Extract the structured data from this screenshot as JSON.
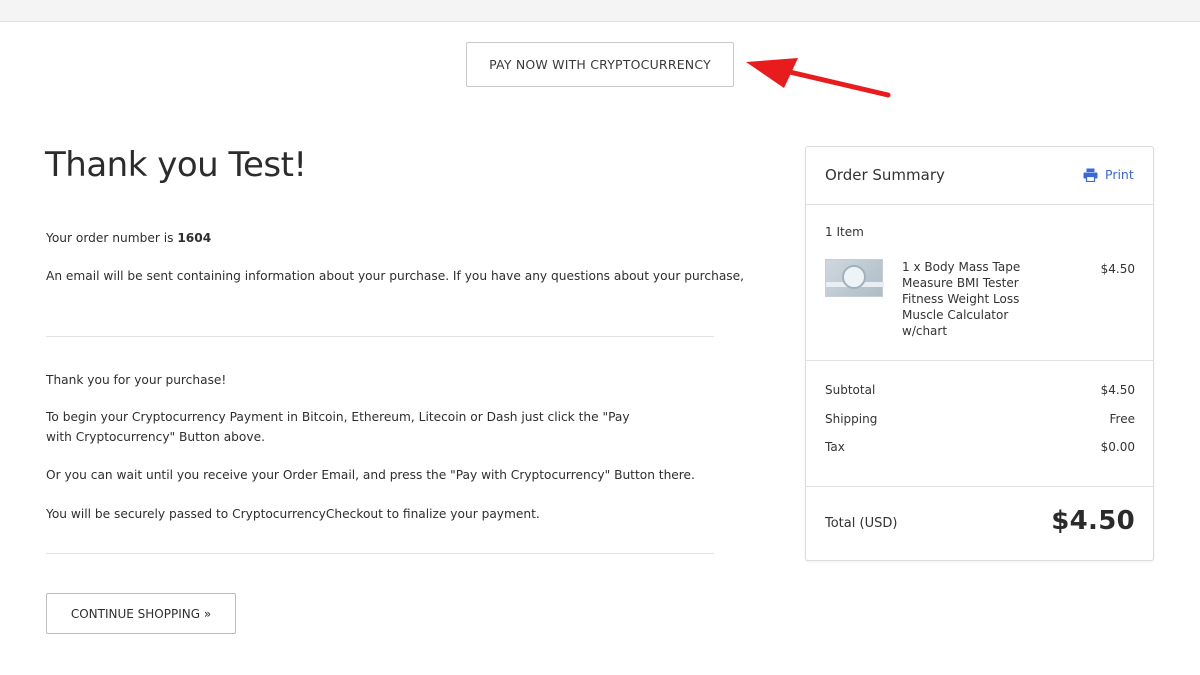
{
  "header": {
    "pay_button_label": "PAY NOW WITH CRYPTOCURRENCY"
  },
  "annotation": {
    "arrow_color": "#e81c1c"
  },
  "main": {
    "heading": "Thank you Test!",
    "order_number_prefix": "Your order number is",
    "order_number": "1604",
    "email_info": "An email will be sent containing information about your purchase. If you have any questions about your purchase,",
    "thanks": "Thank you for your purchase!",
    "instructions": "To begin your Cryptocurrency Payment in Bitcoin, Ethereum, Litecoin or Dash just click the \"Pay with Cryptocurrency\" Button above.",
    "alternative": "Or you can wait until you receive your Order Email, and press the \"Pay with Cryptocurrency\" Button there.",
    "secure_note": "You will be securely passed to CryptocurrencyCheckout to finalize your payment.",
    "continue_button_label": "CONTINUE SHOPPING »"
  },
  "summary": {
    "title": "Order Summary",
    "print_label": "Print",
    "print_icon": "printer-icon",
    "items_count": "1 Item",
    "items": [
      {
        "name": "1 x Body Mass Tape Measure BMI Tester Fitness Weight Loss Muscle Calculator w/chart",
        "price": "$4.50"
      }
    ],
    "subtotal_label": "Subtotal",
    "subtotal_value": "$4.50",
    "shipping_label": "Shipping",
    "shipping_value": "Free",
    "tax_label": "Tax",
    "tax_value": "$0.00",
    "total_label": "Total (USD)",
    "total_value": "$4.50"
  },
  "colors": {
    "accent_link": "#3a68d8",
    "border": "#dcdcdc"
  }
}
